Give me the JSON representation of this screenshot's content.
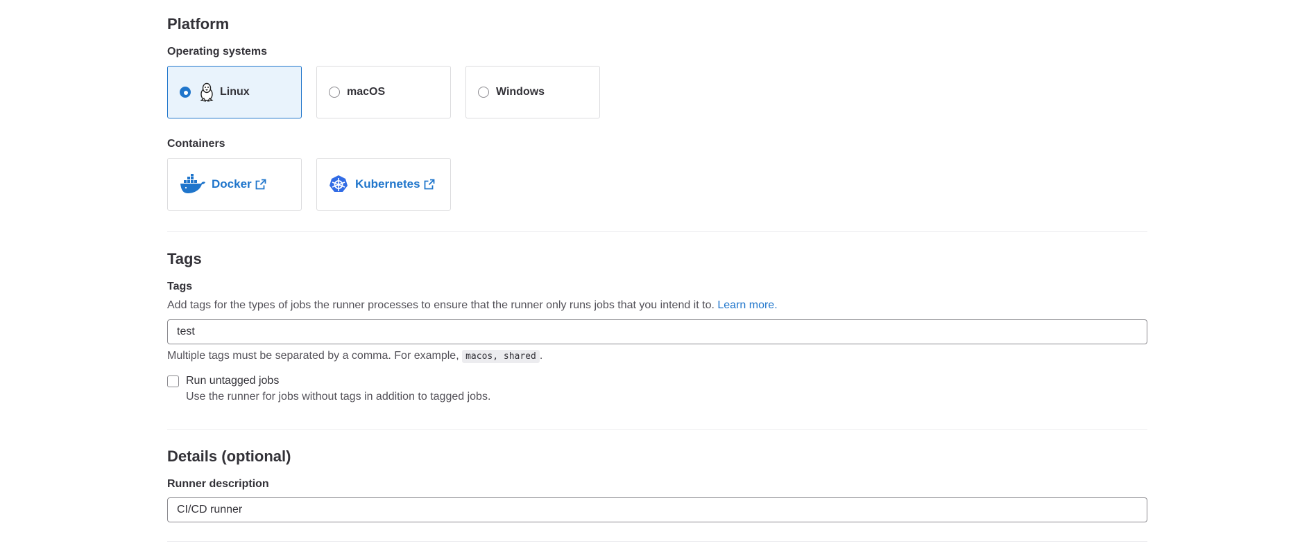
{
  "platform": {
    "title": "Platform",
    "os_label": "Operating systems",
    "os_options": [
      {
        "label": "Linux",
        "selected": true
      },
      {
        "label": "macOS",
        "selected": false
      },
      {
        "label": "Windows",
        "selected": false
      }
    ],
    "containers_label": "Containers",
    "containers": [
      {
        "label": "Docker",
        "icon": "docker-icon"
      },
      {
        "label": "Kubernetes",
        "icon": "kubernetes-icon"
      }
    ]
  },
  "tags": {
    "title": "Tags",
    "field_label": "Tags",
    "help_text": "Add tags for the types of jobs the runner processes to ensure that the runner only runs jobs that you intend it to.",
    "learn_more": "Learn more.",
    "value": "test",
    "separator_help_prefix": "Multiple tags must be separated by a comma. For example,",
    "separator_example": "macos, shared",
    "separator_help_suffix": ".",
    "untagged_label": "Run untagged jobs",
    "untagged_checked": false,
    "untagged_help": "Use the runner for jobs without tags in addition to tagged jobs."
  },
  "details": {
    "title": "Details (optional)",
    "description_label": "Runner description",
    "description_value": "CI/CD runner"
  },
  "colors": {
    "accent": "#1f75cb",
    "selected_bg": "#e9f3fc",
    "border": "#dcdcde"
  }
}
